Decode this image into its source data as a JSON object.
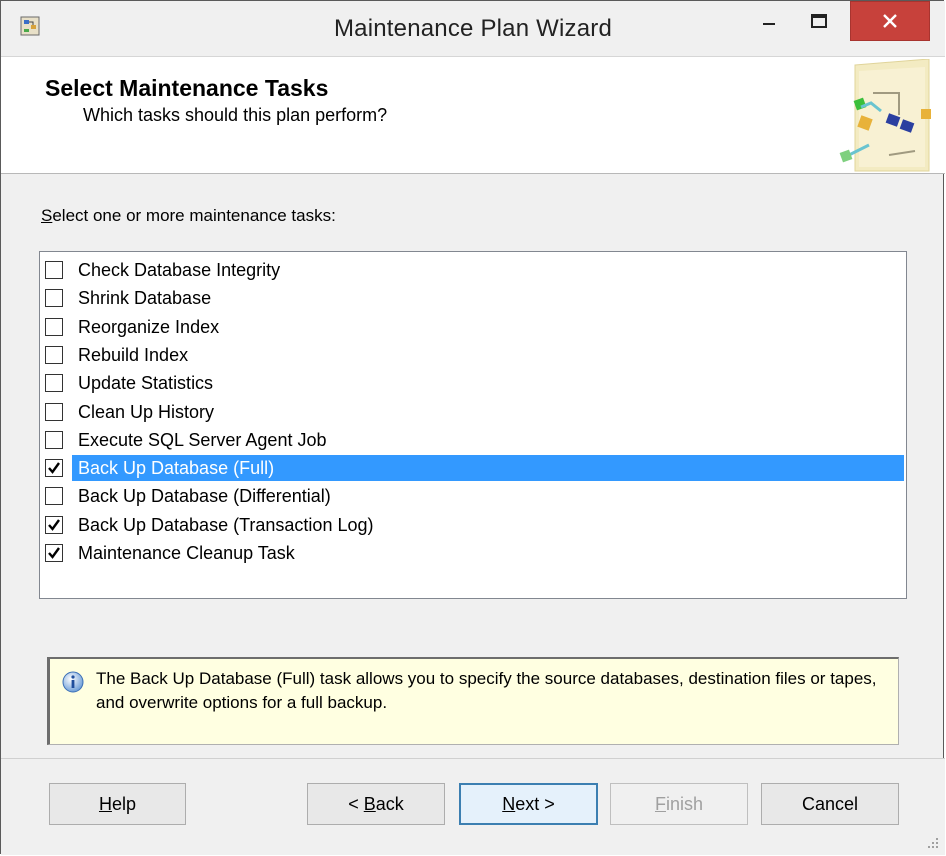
{
  "window": {
    "title": "Maintenance Plan Wizard",
    "icons": {
      "app": "wizard-app-icon",
      "minimize": "minimize-icon",
      "maximize": "maximize-icon",
      "close": "close-icon"
    }
  },
  "header": {
    "title": "Select Maintenance Tasks",
    "subtitle": "Which tasks should this plan perform?",
    "graphic": "wizard-flow-graphic"
  },
  "instructions": {
    "underlined": "S",
    "rest": "elect one or more maintenance tasks:"
  },
  "tasks": [
    {
      "label": "Check Database Integrity",
      "checked": false,
      "selected": false
    },
    {
      "label": "Shrink Database",
      "checked": false,
      "selected": false
    },
    {
      "label": "Reorganize Index",
      "checked": false,
      "selected": false
    },
    {
      "label": "Rebuild Index",
      "checked": false,
      "selected": false
    },
    {
      "label": "Update Statistics",
      "checked": false,
      "selected": false
    },
    {
      "label": "Clean Up History",
      "checked": false,
      "selected": false
    },
    {
      "label": "Execute SQL Server Agent Job",
      "checked": false,
      "selected": false
    },
    {
      "label": "Back Up Database (Full)",
      "checked": true,
      "selected": true
    },
    {
      "label": "Back Up Database (Differential)",
      "checked": false,
      "selected": false
    },
    {
      "label": "Back Up Database (Transaction Log)",
      "checked": true,
      "selected": false
    },
    {
      "label": "Maintenance Cleanup Task",
      "checked": true,
      "selected": false
    }
  ],
  "info": {
    "text": "The Back Up Database (Full) task allows you to specify the source databases, destination files or tapes, and overwrite options for a full backup.",
    "icon": "info-icon"
  },
  "buttons": {
    "help": {
      "accel": "H",
      "rest": "elp"
    },
    "back": {
      "pre": "< ",
      "accel": "B",
      "rest": "ack"
    },
    "next": {
      "accel": "N",
      "rest": "ext >"
    },
    "finish": {
      "accel": "F",
      "rest": "inish"
    },
    "cancel": {
      "label": "Cancel"
    }
  },
  "colors": {
    "selection": "#3399ff",
    "info_background": "#ffffe1",
    "close_button": "#c7413b"
  }
}
